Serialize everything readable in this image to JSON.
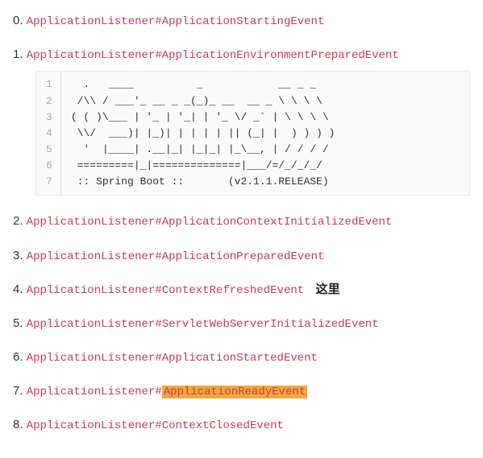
{
  "events": [
    {
      "text": "ApplicationListener#ApplicationStartingEvent"
    },
    {
      "text": "ApplicationListener#ApplicationEnvironmentPreparedEvent"
    },
    {
      "text": "ApplicationListener#ApplicationContextInitializedEvent"
    },
    {
      "text": "ApplicationListener#ApplicationPreparedEvent"
    },
    {
      "text": "ApplicationListener#ContextRefreshedEvent",
      "annotation": "这里"
    },
    {
      "text": "ApplicationListener#ServletWebServerInitializedEvent"
    },
    {
      "text": "ApplicationListener#ApplicationStartedEvent"
    },
    {
      "prefix": "ApplicationListener#",
      "highlight": "ApplicationReadyEvent"
    },
    {
      "text": "ApplicationListener#ContextClosedEvent"
    }
  ],
  "banner": {
    "gutter": "1\n2\n3\n4\n5\n6\n7",
    "lines": "  .   ____          _            __ _ _\n /\\\\ / ___'_ __ _ _(_)_ __  __ _ \\ \\ \\ \\\n( ( )\\___ | '_ | '_| | '_ \\/ _` | \\ \\ \\ \\\n \\\\/  ___)| |_)| | | | | || (_| |  ) ) ) )\n  '  |____| .__|_| |_|_| |_\\__, | / / / /\n =========|_|==============|___/=/_/_/_/\n :: Spring Boot ::       (v2.1.1.RELEASE)"
  }
}
